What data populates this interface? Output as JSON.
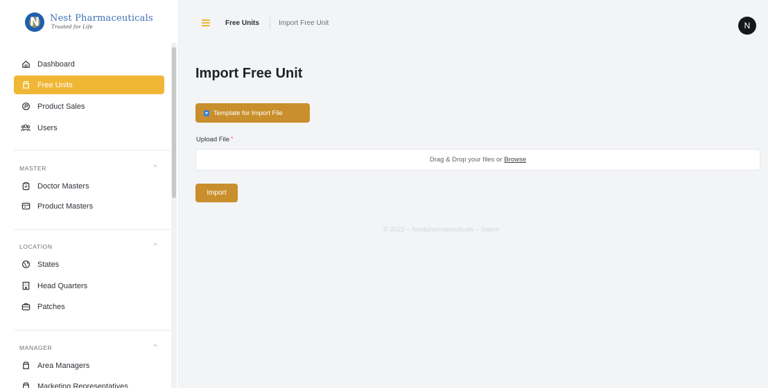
{
  "brand": {
    "name": "Nest Pharmaceuticals",
    "tagline": "Trusted for Life",
    "mark": "N"
  },
  "nav": {
    "main": [
      {
        "label": "Dashboard",
        "icon": "home-icon",
        "active": false
      },
      {
        "label": "Free Units",
        "icon": "box-icon",
        "active": true
      },
      {
        "label": "Product Sales",
        "icon": "sales-icon",
        "active": false
      },
      {
        "label": "Users",
        "icon": "users-icon",
        "active": false
      }
    ],
    "master": {
      "label": "MASTER",
      "items": [
        {
          "label": "Doctor Masters",
          "icon": "clipboard-icon"
        },
        {
          "label": "Product Masters",
          "icon": "product-icon"
        }
      ]
    },
    "location": {
      "label": "LOCATION",
      "items": [
        {
          "label": "States",
          "icon": "globe-icon"
        },
        {
          "label": "Head Quarters",
          "icon": "building-icon"
        },
        {
          "label": "Patches",
          "icon": "briefcase-icon"
        }
      ]
    },
    "manager": {
      "label": "MANAGER",
      "items": [
        {
          "label": "Area Managers",
          "icon": "box-icon"
        },
        {
          "label": "Marketing Representatives",
          "icon": "box-icon"
        }
      ]
    },
    "caret": "^"
  },
  "header": {
    "breadcrumb_parent": "Free Units",
    "breadcrumb_current": "Import Free Unit",
    "avatar_initial": "N"
  },
  "main": {
    "title": "Import Free Unit",
    "template_button": "Template for Import File",
    "upload_label": "Upload File",
    "required_mark": "*",
    "dropzone_text": "Drag & Drop your files or",
    "dropzone_link": "Browse",
    "import_button": "Import"
  },
  "footer": {
    "text": "© 2022 – Nestpharmaceuticals – Salem"
  },
  "colors": {
    "accent": "#f0b737",
    "button": "#c98f2c",
    "brand_blue": "#1f5fae"
  }
}
